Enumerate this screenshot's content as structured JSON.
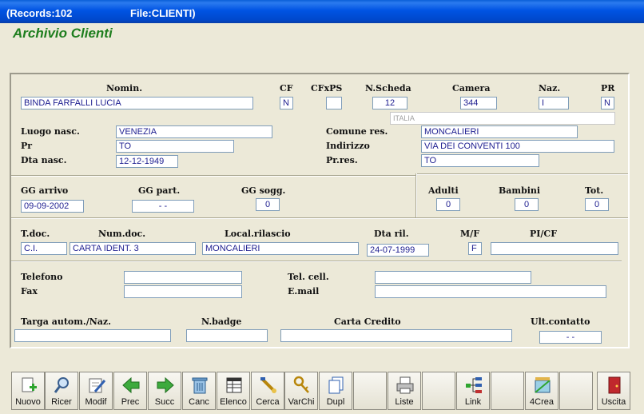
{
  "window": {
    "records": "(Records:102",
    "file": "File:CLIENTI)"
  },
  "app_title": "Archivio Clienti",
  "labels": {
    "nomin": "Nomin.",
    "cf": "CF",
    "cfxps": "CFxPS",
    "nscheda": "N.Scheda",
    "camera": "Camera",
    "naz": "Naz.",
    "pr": "PR",
    "luogo_nasc": "Luogo nasc.",
    "pr2": "Pr",
    "dta_nasc": "Dta nasc.",
    "comune_res": "Comune res.",
    "indirizzo": "Indirizzo",
    "pr_res": "Pr.res.",
    "gg_arrivo": "GG arrivo",
    "gg_part": "GG part.",
    "gg_sogg": "GG sogg.",
    "adulti": "Adulti",
    "bambini": "Bambini",
    "tot": "Tot.",
    "tdoc": "T.doc.",
    "num_doc": "Num.doc.",
    "local_rilascio": "Local.rilascio",
    "dta_ril": "Dta ril.",
    "mf": "M/F",
    "pi_cf": "PI/CF",
    "telefono": "Telefono",
    "tel_cell": "Tel. cell.",
    "fax": "Fax",
    "email": "E.mail",
    "targa": "Targa autom./Naz.",
    "nbadge": "N.badge",
    "carta_credito": "Carta Credito",
    "ult_contatto": "Ult.contatto"
  },
  "values": {
    "nomin": "BINDA FARFALLI LUCIA",
    "cf": "N",
    "cfxps": "",
    "nscheda": "12",
    "camera": "344",
    "naz": "I",
    "pr": "N",
    "nazione": "ITALIA",
    "luogo_nasc": "VENEZIA",
    "pr2": "TO",
    "dta_nasc": "12-12-1949",
    "comune_res": "MONCALIERI",
    "indirizzo": "VIA DEI CONVENTI 100",
    "pr_res": "TO",
    "gg_arrivo": "09-09-2002",
    "gg_part": "-   -",
    "gg_sogg": "0",
    "adulti": "0",
    "bambini": "0",
    "tot": "0",
    "tdoc": "C.I.",
    "num_doc": "CARTA IDENT. 3",
    "local_rilascio": "MONCALIERI",
    "dta_ril": "24-07-1999",
    "mf": "F",
    "pi_cf": "",
    "telefono": "",
    "tel_cell": "",
    "fax": "",
    "email": "",
    "targa": "",
    "nbadge": "",
    "carta_credito": "",
    "ult_contatto": "-   -"
  },
  "toolbar": [
    {
      "label": "Nuovo",
      "icon": "new-record-icon"
    },
    {
      "label": "Ricer",
      "icon": "search-icon"
    },
    {
      "label": "Modif",
      "icon": "edit-icon"
    },
    {
      "label": "Prec",
      "icon": "arrow-left-icon"
    },
    {
      "label": "Succ",
      "icon": "arrow-right-icon"
    },
    {
      "label": "Canc",
      "icon": "trash-icon"
    },
    {
      "label": "Elenco",
      "icon": "list-icon"
    },
    {
      "label": "Cerca",
      "icon": "find-icon"
    },
    {
      "label": "VarChi",
      "icon": "keys-icon"
    },
    {
      "label": "Dupl",
      "icon": "duplicate-icon"
    },
    {
      "label": "",
      "icon": ""
    },
    {
      "label": "Liste",
      "icon": "printer-icon"
    },
    {
      "label": "",
      "icon": ""
    },
    {
      "label": "Link",
      "icon": "link-icon"
    },
    {
      "label": "",
      "icon": ""
    },
    {
      "label": "4Crea",
      "icon": "create-icon"
    },
    {
      "label": "",
      "icon": ""
    },
    {
      "label": "Uscita",
      "icon": "exit-icon"
    }
  ],
  "colors": {
    "accent": "#0054E3",
    "title_green": "#1E7E1E",
    "field_text": "#1E1E90"
  }
}
